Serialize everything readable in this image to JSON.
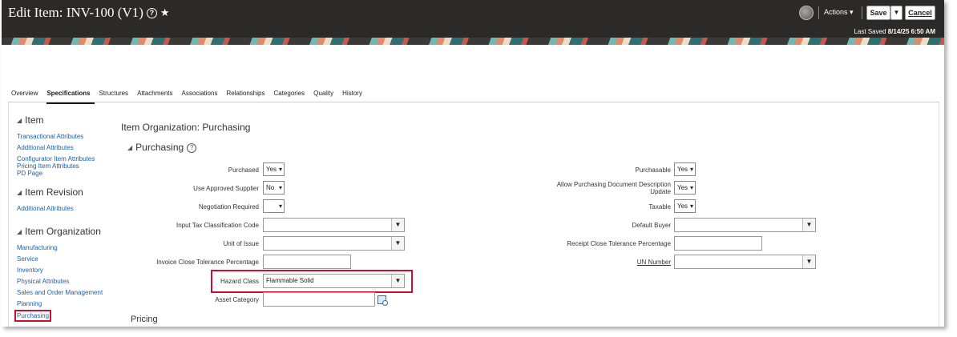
{
  "header": {
    "title": "Edit Item: INV-100 (V1)",
    "help_glyph": "?",
    "star_glyph": "★",
    "actions_label": "Actions ▾",
    "save_label": "Save",
    "save_drop_glyph": "▼",
    "cancel_label": "Cancel",
    "last_saved_label": "Last Saved",
    "last_saved_value": "8/14/25 6:50 AM"
  },
  "tabs": [
    {
      "label": "Overview",
      "active": false
    },
    {
      "label": "Specifications",
      "active": true
    },
    {
      "label": "Structures",
      "active": false
    },
    {
      "label": "Attachments",
      "active": false
    },
    {
      "label": "Associations",
      "active": false
    },
    {
      "label": "Relationships",
      "active": false
    },
    {
      "label": "Categories",
      "active": false
    },
    {
      "label": "Quality",
      "active": false
    },
    {
      "label": "History",
      "active": false
    }
  ],
  "nav": {
    "item_head": "Item",
    "item_links": [
      "Transactional Attributes",
      "Additional Attributes",
      "Configurator Item Attributes",
      "Pricing Item Attributes",
      "PD Page"
    ],
    "revision_head": "Item Revision",
    "revision_links": [
      "Additional Attributes"
    ],
    "org_head": "Item Organization",
    "org_links": [
      "Manufacturing",
      "Service",
      "Inventory",
      "Physical Attributes",
      "Sales and Order Management",
      "Planning",
      "Purchasing"
    ],
    "selected_link": "Purchasing"
  },
  "main": {
    "section_title": "Item Organization: Purchasing",
    "subsection_title": "Purchasing",
    "pricing_title": "Pricing",
    "tri_glyph": "◢",
    "caret_glyph": "▾",
    "drop_glyph": "▼",
    "left_fields": {
      "purchased": {
        "label": "Purchased",
        "value": "Yes"
      },
      "use_approved_supplier": {
        "label": "Use Approved Supplier",
        "value": "No"
      },
      "negotiation_required": {
        "label": "Negotiation Required",
        "value": ""
      },
      "input_tax_classification_code": {
        "label": "Input Tax Classification Code",
        "value": ""
      },
      "unit_of_issue": {
        "label": "Unit of Issue",
        "value": ""
      },
      "invoice_close_tolerance_percentage": {
        "label": "Invoice Close Tolerance Percentage",
        "value": ""
      },
      "hazard_class": {
        "label": "Hazard Class",
        "value": "Flammable Solid"
      },
      "asset_category": {
        "label": "Asset Category",
        "value": ""
      }
    },
    "right_fields": {
      "purchasable": {
        "label": "Purchasable",
        "value": "Yes"
      },
      "allow_purchasing_document_description_update": {
        "label": "Allow Purchasing Document Description Update",
        "value": "Yes"
      },
      "taxable": {
        "label": "Taxable",
        "value": "Yes"
      },
      "default_buyer": {
        "label": "Default Buyer",
        "value": ""
      },
      "receipt_close_tolerance_percentage": {
        "label": "Receipt Close Tolerance Percentage",
        "value": ""
      },
      "un_number": {
        "label": "UN Number",
        "value": ""
      }
    }
  },
  "colors": {
    "header_bg": "#2b2a28",
    "link": "#1f5fa0",
    "highlight": "#c8102e"
  }
}
